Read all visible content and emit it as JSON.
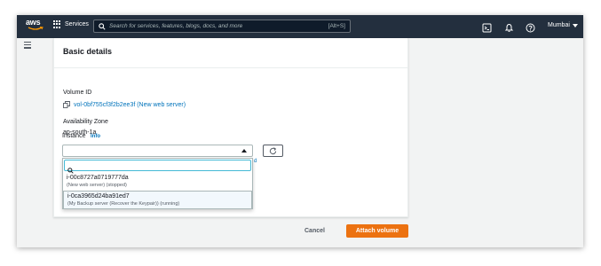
{
  "topnav": {
    "logo_text": "aws",
    "services_label": "Services",
    "search_placeholder": "Search for services, features, blogs, docs, and more",
    "search_shortcut": "[Alt+S]",
    "region_label": "Mumbai"
  },
  "card": {
    "title": "Basic details",
    "volume_id_label": "Volume ID",
    "volume_id_value": "vol-0bf755cf3f2b2ee3f (New web server)",
    "az_label": "Availability Zone",
    "az_value": "ap-south-1a",
    "instance_label": "Instance",
    "instance_info": "Info",
    "instance_trailing": "d"
  },
  "dropdown": {
    "search_value": "",
    "options": [
      {
        "id": "i-00c8727a0719777da",
        "desc": "(New web server) (stopped)"
      },
      {
        "id": "i-0ca3965d24ba91ed7",
        "desc": "(My Backup server (Recover the Keypair)) (running)"
      }
    ]
  },
  "footer": {
    "cancel_label": "Cancel",
    "attach_label": "Attach volume"
  },
  "colors": {
    "nav_bg": "#232f3e",
    "link": "#0073bb",
    "primary_button": "#ec7211",
    "focus": "#44b9d6"
  }
}
